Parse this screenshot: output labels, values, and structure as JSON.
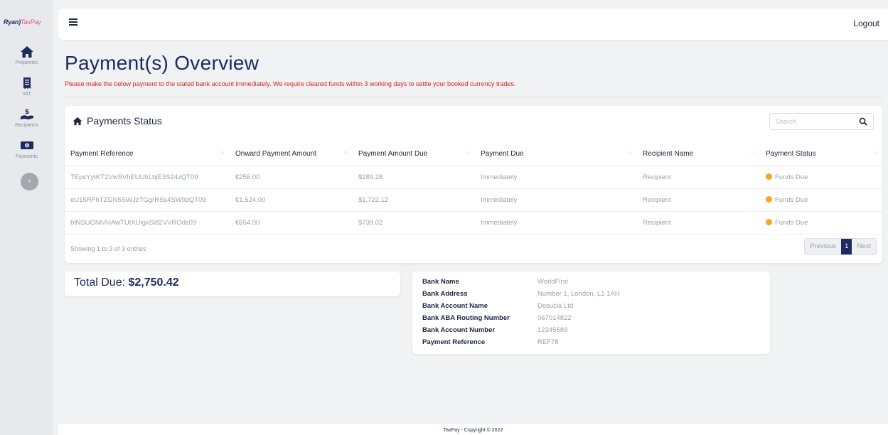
{
  "app": {
    "logo_text": "Ryan",
    "logo_accent": "TaxPay"
  },
  "sidebar": {
    "items": [
      {
        "label": "Properties",
        "icon": "home-icon"
      },
      {
        "label": "VAT",
        "icon": "receipt-icon"
      },
      {
        "label": "Recipients",
        "icon": "hand-dollar-icon"
      },
      {
        "label": "Payments",
        "icon": "banknote-icon"
      }
    ],
    "collapse_glyph": "›"
  },
  "header": {
    "logout_label": "Logout"
  },
  "main": {
    "title": "Payment(s) Overview",
    "warning": "Please make the below payment to the stated bank account immediately. We require cleared funds within 3 working days to settle your booked currency trades."
  },
  "payments": {
    "title": "Payments Status",
    "search_placeholder": "Search",
    "columns": [
      "Payment Reference",
      "Onward Payment Amount",
      "Payment Amount Due",
      "Payment Due",
      "Recipient Name",
      "Payment Status"
    ],
    "rows": [
      [
        "TEpsYytKT2VwSVhEUUhLbjE3S24zQT09",
        "€256.00",
        "$289.28",
        "Immediately",
        "Recipient",
        "Funds Due"
      ],
      [
        "eU15RFhTZGN5SWJzTGgrRSs4SW9zQT09",
        "€1,524.00",
        "$1,722.12",
        "Immediately",
        "Recipient",
        "Funds Due"
      ],
      [
        "blNSUGNiVHAwTUtXUlgxSi82VVROdz09",
        "€654.00",
        "$739.02",
        "Immediately",
        "Recipient",
        "Funds Due"
      ]
    ],
    "showing": "Showing 1 to 3 of 3 entries",
    "pager": {
      "previous": "Previous",
      "page": "1",
      "next": "Next"
    },
    "status_color": "#f5a623"
  },
  "total": {
    "label": "Total Due:",
    "amount": "$2,750.42"
  },
  "bank": {
    "rows": [
      {
        "key": "Bank Name",
        "value": "WorldFirst"
      },
      {
        "key": "Bank Address",
        "value": "Number 1, London, L1 1AH"
      },
      {
        "key": "Bank Account Name",
        "value": "Desucla Ltd"
      },
      {
        "key": "Bank ABA Routing Number",
        "value": "067014822"
      },
      {
        "key": "Bank Account Number",
        "value": "12345689"
      },
      {
        "key": "Payment Reference",
        "value": "REF78"
      }
    ]
  },
  "footer": {
    "text": "TaxPay - Copyright © 2022"
  },
  "colors": {
    "brand_navy": "#1f2a60",
    "warning_red": "#e02020",
    "accent_pink": "#e94d8a"
  }
}
